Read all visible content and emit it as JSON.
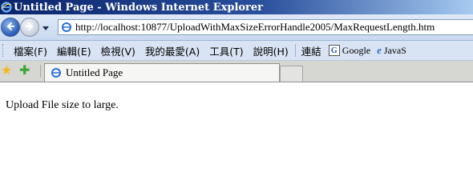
{
  "window": {
    "title": "Untitled Page - Windows Internet Explorer",
    "title_bar_color": "#0a246a"
  },
  "navigation": {
    "back_icon": "back-arrow-icon",
    "forward_icon": "forward-arrow-icon",
    "url": "http://localhost:10877/UploadWithMaxSizeErrorHandle2005/MaxRequestLength.htm"
  },
  "menu": {
    "items": [
      {
        "label": "檔案(F)"
      },
      {
        "label": "編輯(E)"
      },
      {
        "label": "檢視(V)"
      },
      {
        "label": "我的最愛(A)"
      },
      {
        "label": "工具(T)"
      },
      {
        "label": "說明(H)"
      }
    ]
  },
  "links": {
    "label": "連結",
    "items": [
      {
        "label": "Google",
        "icon": "google-icon"
      },
      {
        "label": "JavaS",
        "icon": "ie-page-icon"
      }
    ]
  },
  "tabs": [
    {
      "label": "Untitled Page",
      "active": true
    }
  ],
  "page": {
    "message": "Upload File size to large."
  }
}
